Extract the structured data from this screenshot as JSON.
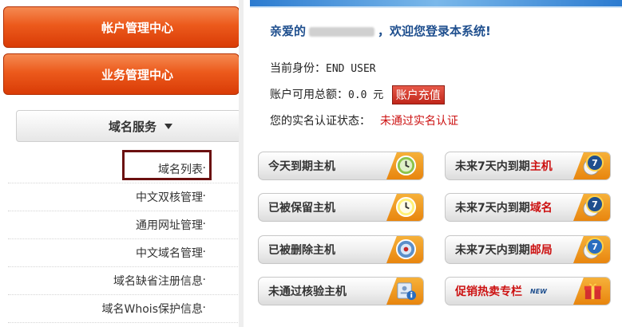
{
  "sidebar": {
    "account_center": "帐户管理中心",
    "business_center": "业务管理中心",
    "domain_service": "域名服务",
    "items": [
      {
        "label": "域名列表"
      },
      {
        "label": "中文双核管理"
      },
      {
        "label": "通用网址管理"
      },
      {
        "label": "中文域名管理"
      },
      {
        "label": "域名缺省注册信息"
      },
      {
        "label": "域名Whois保护信息"
      }
    ]
  },
  "welcome": {
    "prefix": "亲爱的",
    "suffix": "，欢迎您登录本系统!"
  },
  "info": {
    "identity_label": "当前身份：",
    "identity_value": "END USER",
    "balance_label": "账户可用总额：",
    "balance_value": "0.0 元",
    "recharge_label": "账户充值",
    "realname_label": "您的实名认证状态：",
    "realname_value": "未通过实名认证"
  },
  "actions": {
    "today_expire_host": "今天到期主机",
    "seven_day_host_prefix": "未来7天内到期",
    "seven_day_host_hl": "主机",
    "reserved_host": "已被保留主机",
    "seven_day_domain_prefix": "未来7天内到期",
    "seven_day_domain_hl": "域名",
    "deleted_host": "已被删除主机",
    "seven_day_mail_prefix": "未来7天内到期",
    "seven_day_mail_hl": "邮局",
    "unverified_host": "未通过核验主机",
    "promo": "促销热卖专栏",
    "promo_tag": "NEW",
    "badge_number": "7"
  },
  "colors": {
    "accent_orange": "#e8540f",
    "link_blue": "#1f4f8e",
    "alert_red": "#cc1111"
  }
}
